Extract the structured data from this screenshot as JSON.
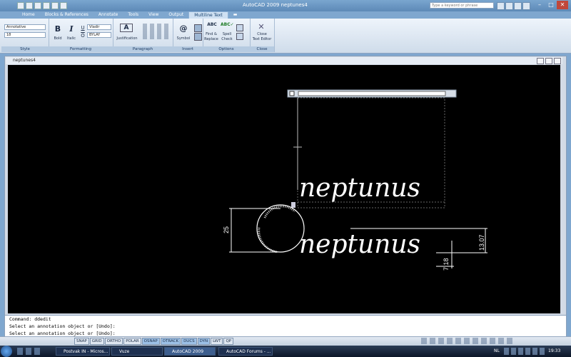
{
  "window": {
    "title": "AutoCAD 2009 neptunes4",
    "help_placeholder": "Type a keyword or phrase",
    "controls": [
      "–",
      "□",
      "✕"
    ]
  },
  "tabs": [
    {
      "label": "Home",
      "active": false
    },
    {
      "label": "Blocks & References",
      "active": false
    },
    {
      "label": "Annotate",
      "active": false
    },
    {
      "label": "Tools",
      "active": false
    },
    {
      "label": "View",
      "active": false
    },
    {
      "label": "Output",
      "active": false
    },
    {
      "label": "Multiline Text",
      "active": true
    }
  ],
  "ribbon": {
    "style": {
      "title": "Style",
      "style_value": "Annotative",
      "height_value": "18"
    },
    "formatting": {
      "title": "Formatting",
      "bold": "Bold",
      "italic": "Italic",
      "font_value": "Vladir",
      "color_value": "BYLAY"
    },
    "paragraph": {
      "title": "Paragraph",
      "justification": "Justification"
    },
    "insert": {
      "title": "Insert",
      "symbol": "Symbol"
    },
    "options": {
      "title": "Options",
      "find_replace_1": "Find &",
      "find_replace_2": "Replace",
      "spell_1": "Spell",
      "spell_2": "Check"
    },
    "close": {
      "title": "Close",
      "close_1": "Close",
      "close_2": "Text Editor"
    }
  },
  "document": {
    "title": "neptunes4"
  },
  "drawing": {
    "editor_text": "neptunus",
    "drawn_text": "neptunus",
    "dim_25": "25",
    "dim_1307": "13.07",
    "dim_718": "7.18"
  },
  "command": [
    "Command: ddedit",
    "Select an annotation object or [Undo]:",
    "Select an annotation object or [Undo]:"
  ],
  "status_toggles": [
    "SNAP",
    "GRID",
    "ORTHO",
    "POLAR",
    "OSNAP",
    "OTRACK",
    "DUCS",
    "DYN",
    "LWT",
    "QP"
  ],
  "taskbar": {
    "items": [
      {
        "label": "Postvak IN - Micros...",
        "active": false
      },
      {
        "label": "Vuze",
        "active": false
      },
      {
        "label": "AutoCAD 2009",
        "active": true
      },
      {
        "label": "AutoCAD Forums - ...",
        "active": false
      }
    ],
    "language": "NL",
    "clock": "19:33"
  }
}
